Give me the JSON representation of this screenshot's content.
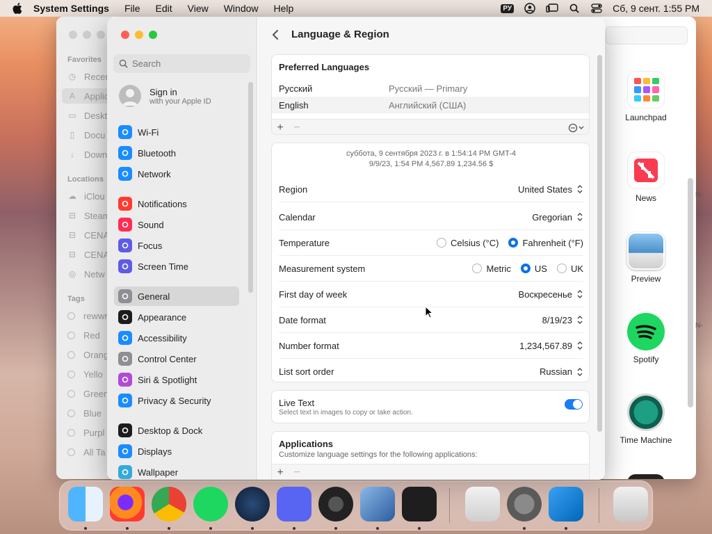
{
  "menubar": {
    "app_name": "System Settings",
    "items": [
      "File",
      "Edit",
      "View",
      "Window",
      "Help"
    ],
    "input_source": "РУ",
    "clock": "Сб, 9 сент.  1:55 PM"
  },
  "finder": {
    "sidebar": {
      "favorites_heading": "Favorites",
      "favorites": [
        "Recen",
        "Applic",
        "Deskt",
        "Docu",
        "Down"
      ],
      "locations_heading": "Locations",
      "locations": [
        "iClou",
        "Steam",
        "CENA",
        "CENA",
        "Netw"
      ],
      "tags_heading": "Tags",
      "tags": [
        "rewwr",
        "Red",
        "Orang",
        "Yello",
        "Green",
        "Blue",
        "Purpl",
        "All Ta"
      ]
    },
    "apps": [
      "Launchpad",
      "News",
      "Preview",
      "Spotify",
      "Time Machine"
    ],
    "edge_marks": [
      "N-",
      "N-"
    ]
  },
  "settings": {
    "search_placeholder": "Search",
    "signin": {
      "title": "Sign in",
      "subtitle": "with your Apple ID"
    },
    "sidebar_groups": [
      [
        {
          "label": "Wi-Fi",
          "color": "#1a8cff",
          "icon": "wifi-icon"
        },
        {
          "label": "Bluetooth",
          "color": "#1a8cff",
          "icon": "bluetooth-icon"
        },
        {
          "label": "Network",
          "color": "#1a8cff",
          "icon": "globe-icon"
        }
      ],
      [
        {
          "label": "Notifications",
          "color": "#ff3b30",
          "icon": "bell-icon"
        },
        {
          "label": "Sound",
          "color": "#ff2d55",
          "icon": "speaker-icon"
        },
        {
          "label": "Focus",
          "color": "#5e5ce6",
          "icon": "moon-icon"
        },
        {
          "label": "Screen Time",
          "color": "#5e5ce6",
          "icon": "hourglass-icon"
        }
      ],
      [
        {
          "label": "General",
          "color": "#8e8e93",
          "icon": "gear-icon",
          "selected": true
        },
        {
          "label": "Appearance",
          "color": "#1c1c1e",
          "icon": "appearance-icon"
        },
        {
          "label": "Accessibility",
          "color": "#1a8cff",
          "icon": "accessibility-icon"
        },
        {
          "label": "Control Center",
          "color": "#8e8e93",
          "icon": "control-center-icon"
        },
        {
          "label": "Siri & Spotlight",
          "color": "#b14ad6",
          "icon": "siri-icon"
        },
        {
          "label": "Privacy & Security",
          "color": "#1a8cff",
          "icon": "hand-icon"
        }
      ],
      [
        {
          "label": "Desktop & Dock",
          "color": "#1c1c1e",
          "icon": "dock-icon"
        },
        {
          "label": "Displays",
          "color": "#1a8cff",
          "icon": "sun-icon"
        },
        {
          "label": "Wallpaper",
          "color": "#34aadc",
          "icon": "wallpaper-icon"
        }
      ]
    ],
    "page_title": "Language & Region",
    "preferred_languages": {
      "heading": "Preferred Languages",
      "rows": [
        {
          "name": "Русский",
          "detail": "Русский — Primary"
        },
        {
          "name": "English",
          "detail": "Английский (США)"
        }
      ]
    },
    "sample_line1": "суббота, 9 сентября 2023 г. в 1:54:14 PM GMT-4",
    "sample_line2": "9/9/23, 1:54 PM     4,567.89     1,234.56 $",
    "settings_rows": {
      "region": {
        "label": "Region",
        "value": "United States"
      },
      "calendar": {
        "label": "Calendar",
        "value": "Gregorian"
      },
      "temperature": {
        "label": "Temperature",
        "options": [
          "Celsius (°C)",
          "Fahrenheit (°F)"
        ],
        "selected": "Fahrenheit (°F)"
      },
      "measurement": {
        "label": "Measurement system",
        "options": [
          "Metric",
          "US",
          "UK"
        ],
        "selected": "US"
      },
      "first_day": {
        "label": "First day of week",
        "value": "Воскресенье"
      },
      "date_format": {
        "label": "Date format",
        "value": "8/19/23"
      },
      "number_format": {
        "label": "Number format",
        "value": "1,234,567.89"
      },
      "sort_order": {
        "label": "List sort order",
        "value": "Russian"
      }
    },
    "live_text": {
      "title": "Live Text",
      "subtitle": "Select text in images to copy or take action.",
      "enabled": true
    },
    "applications": {
      "title": "Applications",
      "subtitle": "Customize language settings for the following applications:"
    }
  },
  "dock": {
    "apps": [
      "finder",
      "firefox",
      "chrome",
      "spotify",
      "steam",
      "discord",
      "obs",
      "virtualbox",
      "terminal",
      "system-information",
      "system-settings",
      "vscode",
      "trash"
    ]
  },
  "colors": {
    "accent": "#0a72e6",
    "sidebar_bg": "#ececec",
    "content_bg": "#f6f6f6"
  }
}
